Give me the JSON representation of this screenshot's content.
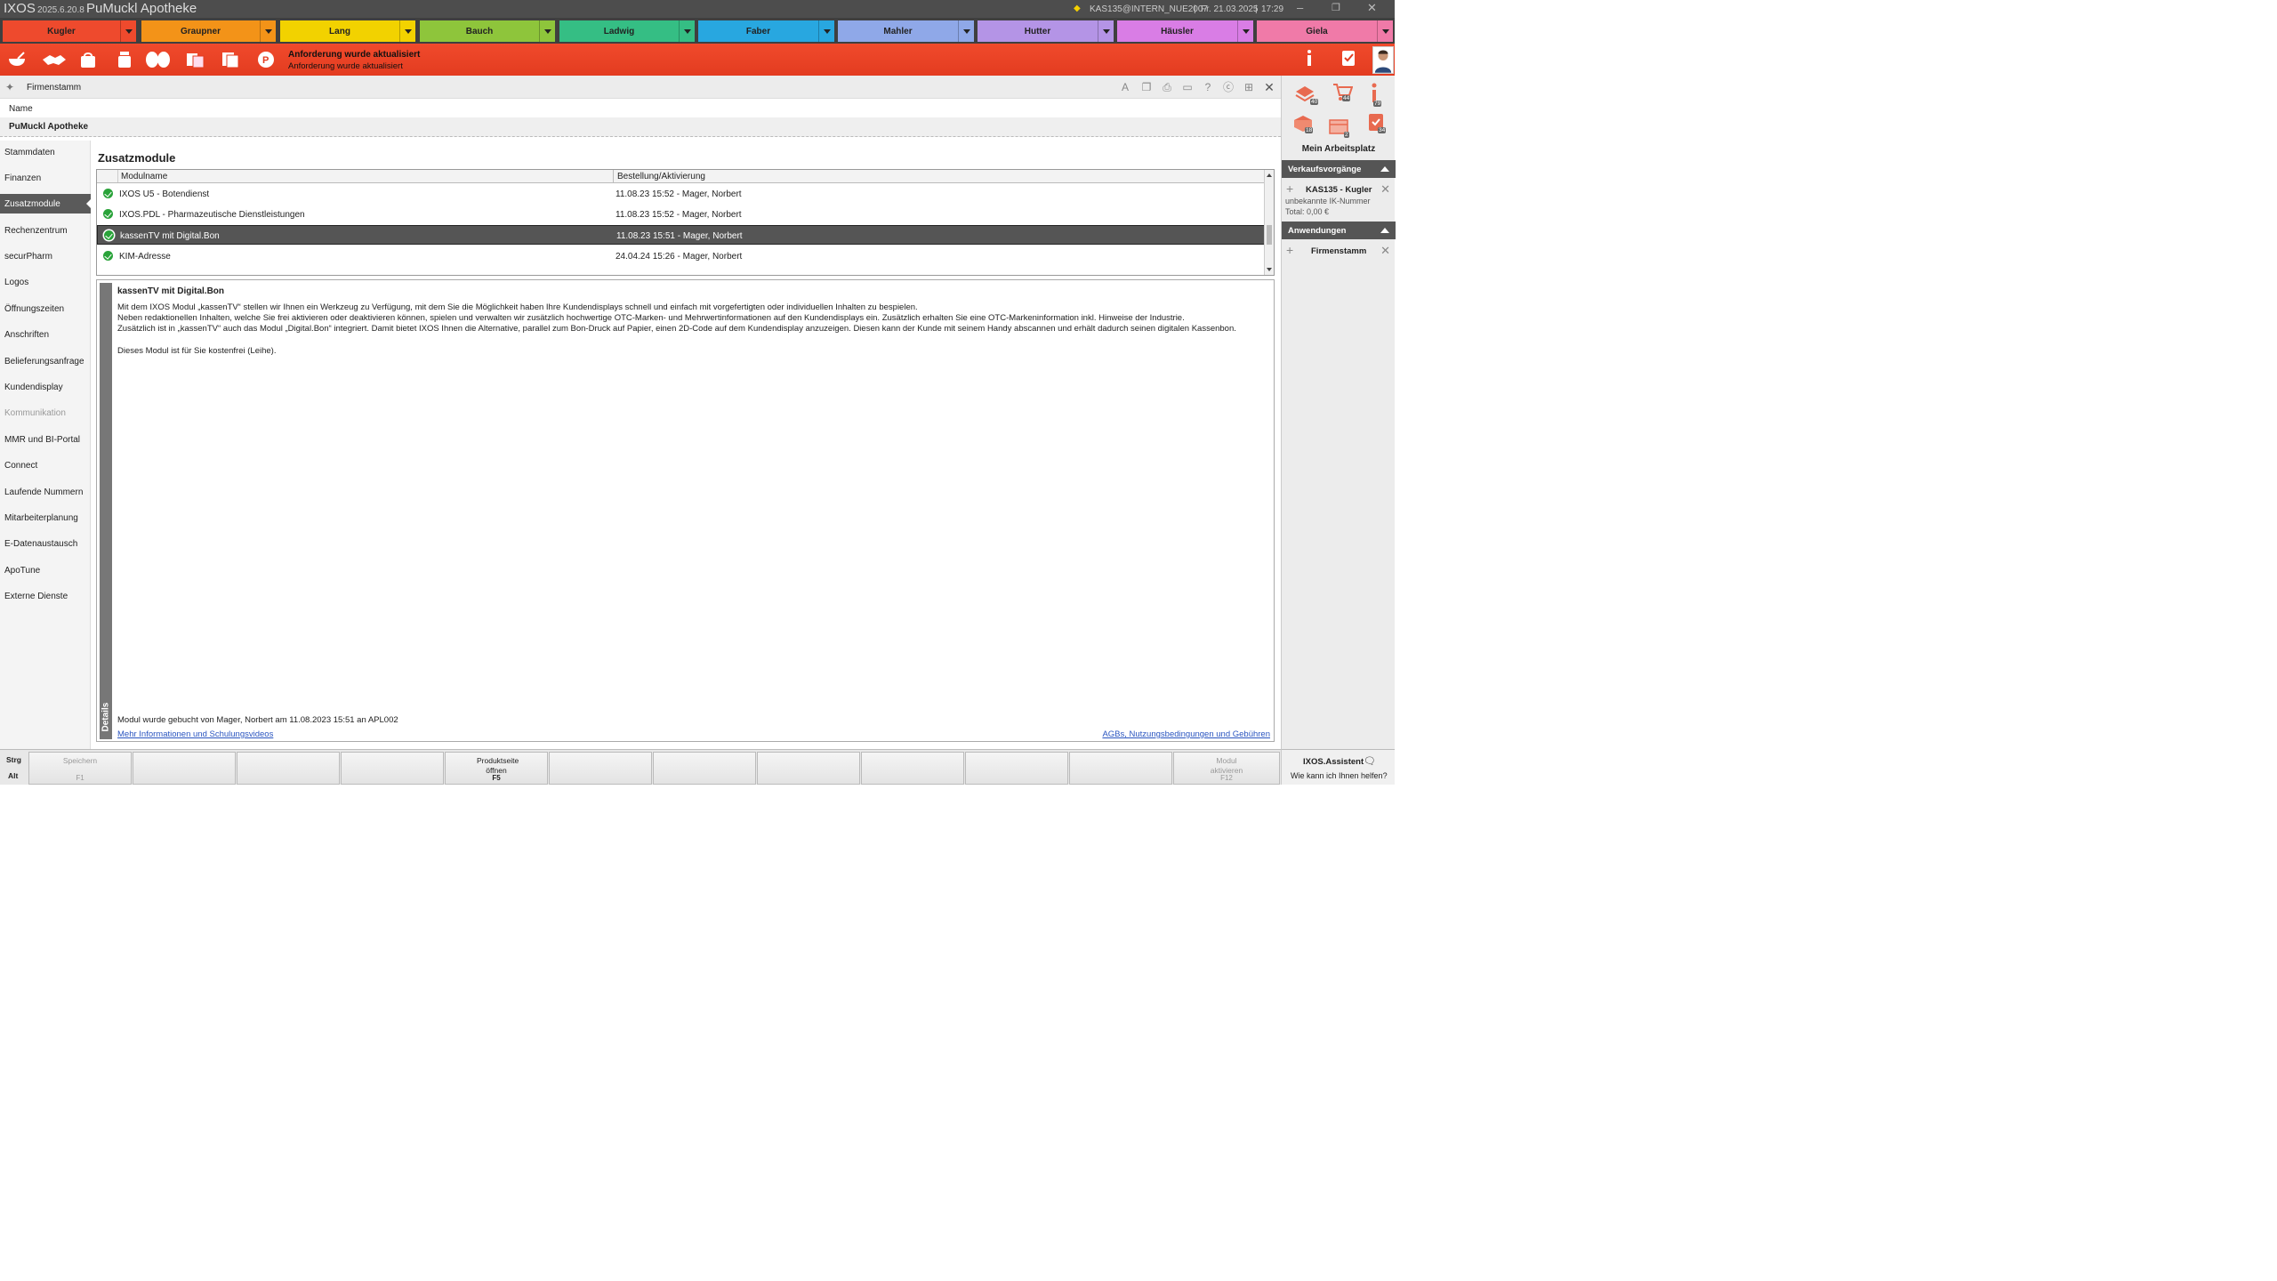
{
  "titlebar": {
    "app": "IXOS",
    "version": "2025.6.20.8",
    "pharmacy": "PuMuckl Apotheke",
    "status": "KAS135@INTERN_NUE2007",
    "date": "Fr. 21.03.2025",
    "time": "17:29",
    "sep": "|"
  },
  "tabs": [
    {
      "label": "Kugler",
      "color": "#ee4a2d"
    },
    {
      "label": "Graupner",
      "color": "#f39318"
    },
    {
      "label": "Lang",
      "color": "#f2d200"
    },
    {
      "label": "Bauch",
      "color": "#8ec53b"
    },
    {
      "label": "Ladwig",
      "color": "#35be84"
    },
    {
      "label": "Faber",
      "color": "#28a7e0"
    },
    {
      "label": "Mahler",
      "color": "#8fa8e8"
    },
    {
      "label": "Hutter",
      "color": "#b494e6"
    },
    {
      "label": "Häusler",
      "color": "#d97de5"
    },
    {
      "label": "Giela",
      "color": "#f07aa8"
    }
  ],
  "redbar": {
    "message_bold": "Anforderung wurde aktualisiert",
    "message": "Anforderung wurde aktualisiert",
    "badge1": "79",
    "badge2": "34",
    "icons": [
      "mortar-icon",
      "handshake-icon",
      "bag-icon",
      "bottle-icon",
      "pills-icon",
      "boxes-icon",
      "documents-icon",
      "prescription-icon"
    ]
  },
  "header": {
    "title": "Firmenstamm"
  },
  "name": {
    "label": "Name",
    "value": "PuMuckl Apotheke"
  },
  "nav": [
    {
      "label": "Stammdaten",
      "state": "normal"
    },
    {
      "label": "Finanzen",
      "state": "normal"
    },
    {
      "label": "Zusatzmodule",
      "state": "active"
    },
    {
      "label": "Rechenzentrum",
      "state": "normal"
    },
    {
      "label": "securPharm",
      "state": "normal"
    },
    {
      "label": "Logos",
      "state": "normal"
    },
    {
      "label": "Öffnungszeiten",
      "state": "normal"
    },
    {
      "label": "Anschriften",
      "state": "normal"
    },
    {
      "label": "Belieferungsanfrage",
      "state": "normal"
    },
    {
      "label": "Kundendisplay",
      "state": "normal"
    },
    {
      "label": "Kommunikation",
      "state": "disabled"
    },
    {
      "label": "MMR und BI-Portal",
      "state": "normal"
    },
    {
      "label": "Connect",
      "state": "normal"
    },
    {
      "label": "Laufende Nummern",
      "state": "normal"
    },
    {
      "label": "Mitarbeiterplanung",
      "state": "normal"
    },
    {
      "label": "E-Datenaustausch",
      "state": "normal"
    },
    {
      "label": "ApoTune",
      "state": "normal"
    },
    {
      "label": "Externe Dienste",
      "state": "normal"
    }
  ],
  "main": {
    "title": "Zusatzmodule",
    "columns": [
      "Modulname",
      "Bestellung/Aktivierung"
    ],
    "rows": [
      {
        "name": "IXOS U5 - Botendienst",
        "activation": "11.08.23 15:52 - Mager, Norbert",
        "selected": false
      },
      {
        "name": "IXOS.PDL - Pharmazeutische Dienstleistungen",
        "activation": "11.08.23 15:52 - Mager, Norbert",
        "selected": false
      },
      {
        "name": "kassenTV mit Digital.Bon",
        "activation": "11.08.23 15:51 - Mager, Norbert",
        "selected": true
      },
      {
        "name": "KIM-Adresse",
        "activation": "24.04.24 15:26 - Mager, Norbert",
        "selected": false
      }
    ]
  },
  "details": {
    "tab_label": "Details",
    "title": "kassenTV mit Digital.Bon",
    "lines": [
      "Mit dem IXOS Modul „kassenTV“ stellen wir Ihnen ein Werkzeug zu Verfügung, mit dem Sie die Möglichkeit haben Ihre Kundendisplays schnell und einfach mit vorgefertigten oder individuellen Inhalten zu bespielen.",
      "Neben redaktionellen Inhalten, welche Sie frei aktivieren oder deaktivieren können, spielen und verwalten wir zusätzlich hochwertige OTC-Marken- und Mehrwertinformationen auf den Kundendisplays ein. Zusätzlich erhalten Sie eine OTC-Markeninformation inkl. Hinweise der Industrie.",
      "Zusätzlich ist in „kassenTV“ auch das Modul „Digital.Bon“ integriert. Damit bietet IXOS Ihnen die Alternative, parallel zum Bon-Druck auf Papier, einen 2D-Code auf dem Kundendisplay anzuzeigen. Diesen kann der Kunde mit seinem Handy abscannen und erhält dadurch seinen digitalen Kassenbon.",
      "Dieses Modul ist für Sie kostenfrei (Leihe)."
    ],
    "footer": "Modul wurde gebucht von Mager, Norbert am 11.08.2023 15:51 an APL002",
    "link_left": "Mehr Informationen und Schulungsvideos",
    "link_right": "AGBs, Nutzungsbedingungen und Gebühren"
  },
  "rightpanel": {
    "workspace_label": "Mein Arbeitsplatz",
    "badges": [
      "40",
      "44",
      "79",
      "18",
      "2",
      "34"
    ],
    "sales_header": "Verkaufsvorgänge",
    "sale": {
      "title": "KAS135 - Kugler",
      "line1": "unbekannte IK-Nummer",
      "line2": "Total: 0,00 €"
    },
    "apps_header": "Anwendungen",
    "app_item": "Firmenstamm"
  },
  "footer": {
    "mod1": "Strg",
    "mod2": "Alt",
    "keys": [
      {
        "label": "Speichern",
        "key": "F1",
        "enabled": false
      },
      {
        "label": "",
        "key": "",
        "enabled": false
      },
      {
        "label": "",
        "key": "",
        "enabled": false
      },
      {
        "label": "",
        "key": "",
        "enabled": false
      },
      {
        "label": "Produktseite öffnen",
        "key": "F5",
        "enabled": true
      },
      {
        "label": "",
        "key": "",
        "enabled": false
      },
      {
        "label": "",
        "key": "",
        "enabled": false
      },
      {
        "label": "",
        "key": "",
        "enabled": false
      },
      {
        "label": "",
        "key": "",
        "enabled": false
      },
      {
        "label": "",
        "key": "",
        "enabled": false
      },
      {
        "label": "",
        "key": "",
        "enabled": false
      },
      {
        "label": "Modul aktivieren",
        "key": "F12",
        "enabled": false
      }
    ],
    "assistant_title": "IXOS.Assistent",
    "assistant_sub": "Wie kann ich Ihnen helfen?"
  }
}
